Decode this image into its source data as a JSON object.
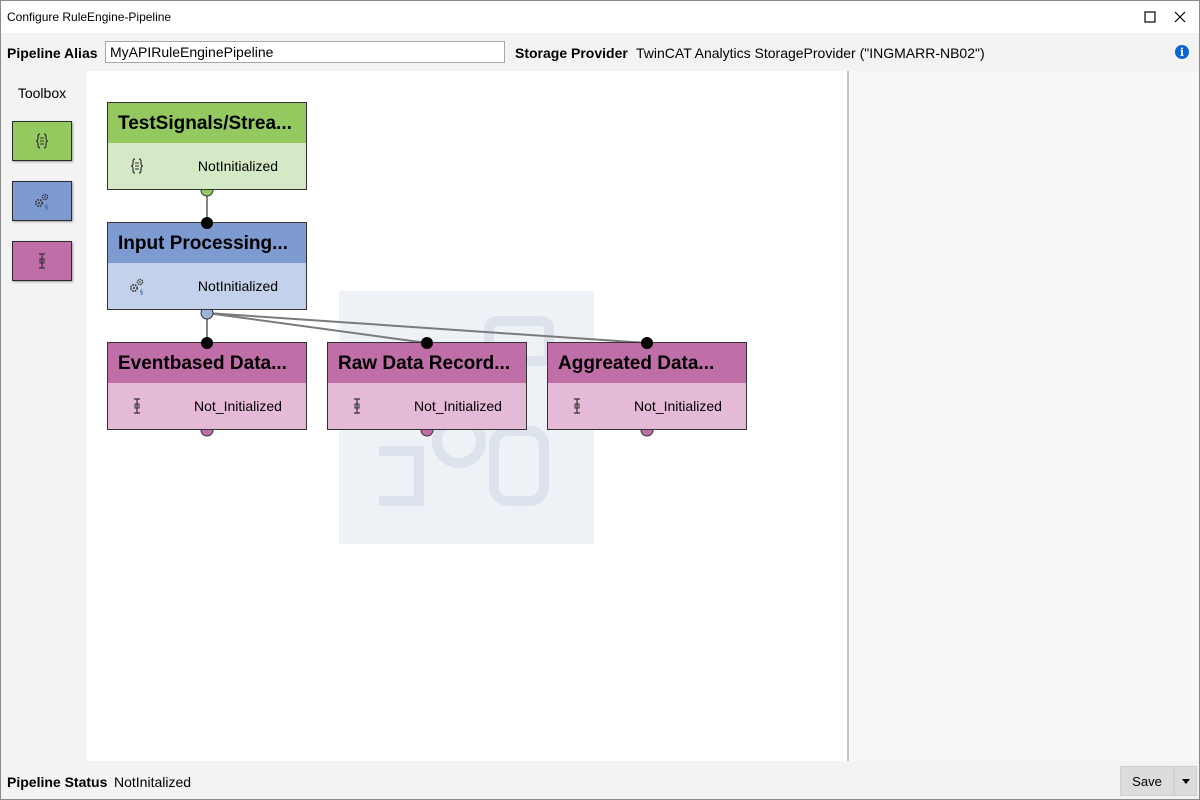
{
  "window": {
    "title": "Configure RuleEngine-Pipeline"
  },
  "alias_bar": {
    "alias_label": "Pipeline Alias",
    "alias_value": "MyAPIRuleEnginePipeline",
    "storage_label": "Storage Provider",
    "storage_value": "TwinCAT Analytics StorageProvider (\"INGMARR-NB02\")",
    "info_icon": "info-icon"
  },
  "toolbox": {
    "title": "Toolbox",
    "items": [
      {
        "icon": "signal-braces-icon",
        "color": "#93c95e"
      },
      {
        "icon": "gears-processing-icon",
        "color": "#7e9bd1"
      },
      {
        "icon": "recorder-icon",
        "color": "#c06ea8"
      }
    ]
  },
  "nodes": [
    {
      "title": "TestSignals/Strea...",
      "status": "NotInitialized",
      "icon": "signal-braces-icon"
    },
    {
      "title": "Input Processing...",
      "status": "NotInitialized",
      "icon": "gears-processing-icon"
    },
    {
      "title": "Eventbased Data...",
      "status": "Not_Initialized",
      "icon": "recorder-icon"
    },
    {
      "title": "Raw Data Record...",
      "status": "Not_Initialized",
      "icon": "recorder-icon"
    },
    {
      "title": "Aggreated Data...",
      "status": "Not_Initialized",
      "icon": "recorder-icon"
    }
  ],
  "status_bar": {
    "label": "Pipeline Status",
    "value": "NotInitalized",
    "save_label": "Save"
  },
  "colors": {
    "source_head": "#93c95e",
    "source_body": "#d6e9c6",
    "processing_head": "#7e9bd1",
    "processing_body": "#c4d1ea",
    "sink_head": "#c06ea8",
    "sink_body": "#e4bad6",
    "accent": "#0a66d6"
  }
}
